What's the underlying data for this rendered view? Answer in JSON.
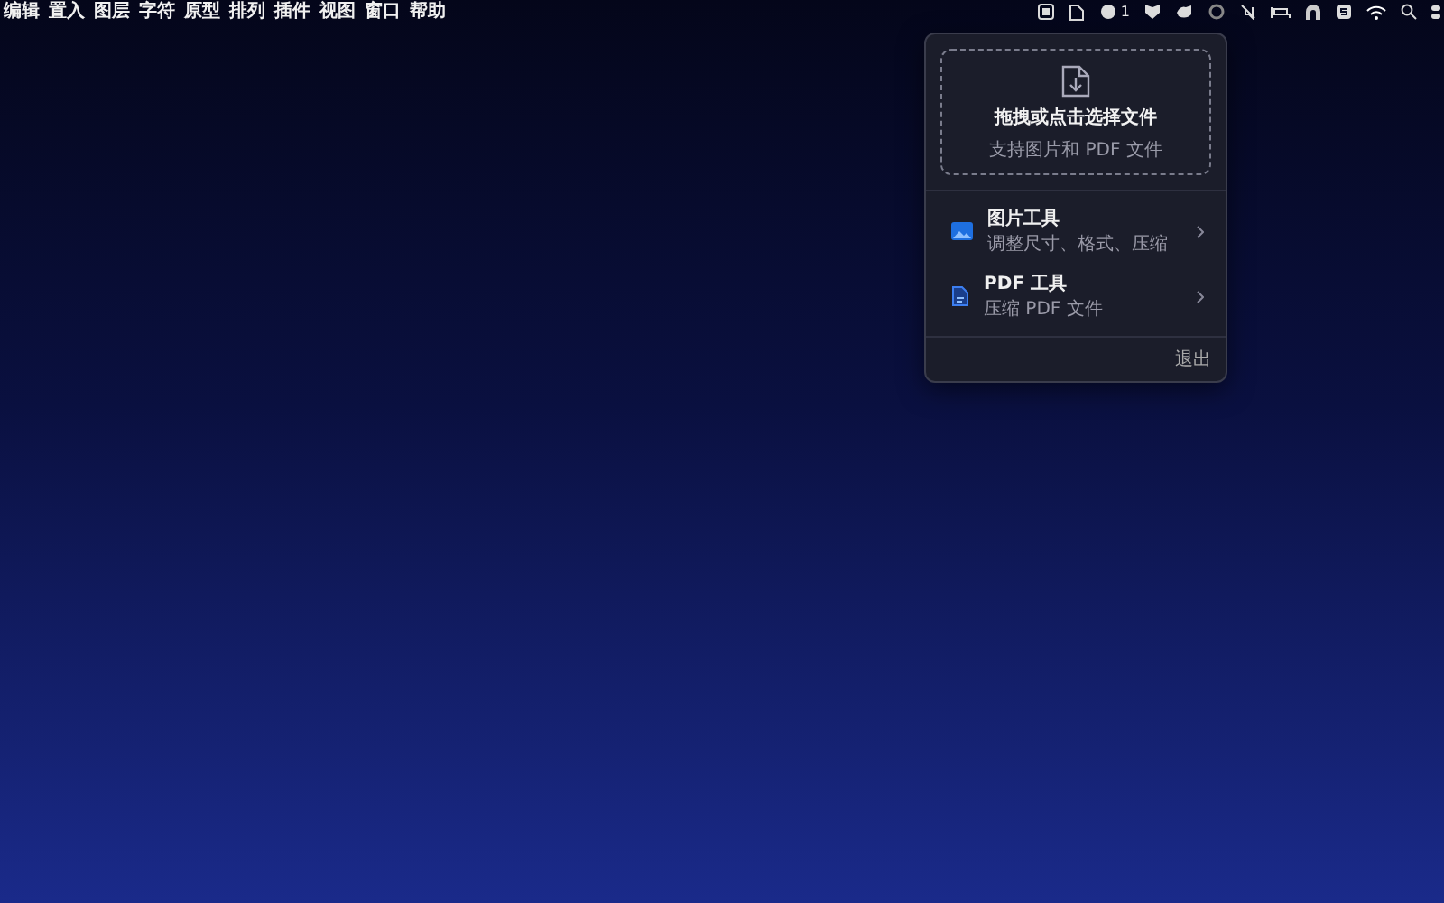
{
  "menu_bar": {
    "items": [
      "编辑",
      "置入",
      "图层",
      "字符",
      "原型",
      "排列",
      "插件",
      "视图",
      "窗口",
      "帮助"
    ],
    "status_count": "1"
  },
  "popup": {
    "drop_zone": {
      "title": "拖拽或点击选择文件",
      "subtitle": "支持图片和 PDF 文件"
    },
    "tools": [
      {
        "kind": "image",
        "title": "图片工具",
        "subtitle": "调整尺寸、格式、压缩"
      },
      {
        "kind": "pdf",
        "title": "PDF 工具",
        "subtitle": "压缩 PDF 文件"
      }
    ],
    "quit": "退出"
  }
}
